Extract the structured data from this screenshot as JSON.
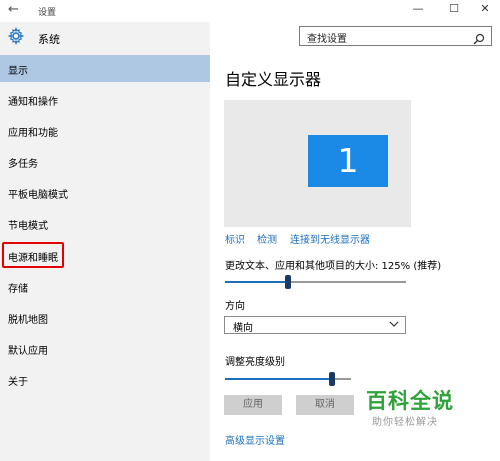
{
  "window": {
    "title": "设置",
    "back_icon": "←",
    "min_icon": "—",
    "max_icon": "☐",
    "close_icon": "✕"
  },
  "header": {
    "title": "系统",
    "search_placeholder": "查找设置"
  },
  "sidebar": {
    "items": [
      {
        "label": "显示",
        "active": true
      },
      {
        "label": "通知和操作"
      },
      {
        "label": "应用和功能"
      },
      {
        "label": "多任务"
      },
      {
        "label": "平板电脑模式"
      },
      {
        "label": "节电模式"
      },
      {
        "label": "电源和睡眠",
        "highlighted": true
      },
      {
        "label": "存储"
      },
      {
        "label": "脱机地图"
      },
      {
        "label": "默认应用"
      },
      {
        "label": "关于"
      }
    ]
  },
  "main": {
    "title": "自定义显示器",
    "monitor_number": "1",
    "links": {
      "identify": "标识",
      "detect": "检测",
      "connect": "连接到无线显示器"
    },
    "scale_label": "更改文本、应用和其他项目的大小: 125% (推荐)",
    "scale_value_fraction": 0.35,
    "orientation_label": "方向",
    "orientation_value": "横向",
    "brightness_label": "调整亮度级别",
    "brightness_value_fraction": 0.85,
    "apply_label": "应用",
    "cancel_label": "取消",
    "advanced_link": "高级显示设置"
  },
  "watermark": {
    "line1": "百科全说",
    "line2": "助你轻松解决"
  },
  "colors": {
    "accent": "#1a8ae6",
    "active_nav": "#aec8e3",
    "highlight_box": "#e10000"
  }
}
